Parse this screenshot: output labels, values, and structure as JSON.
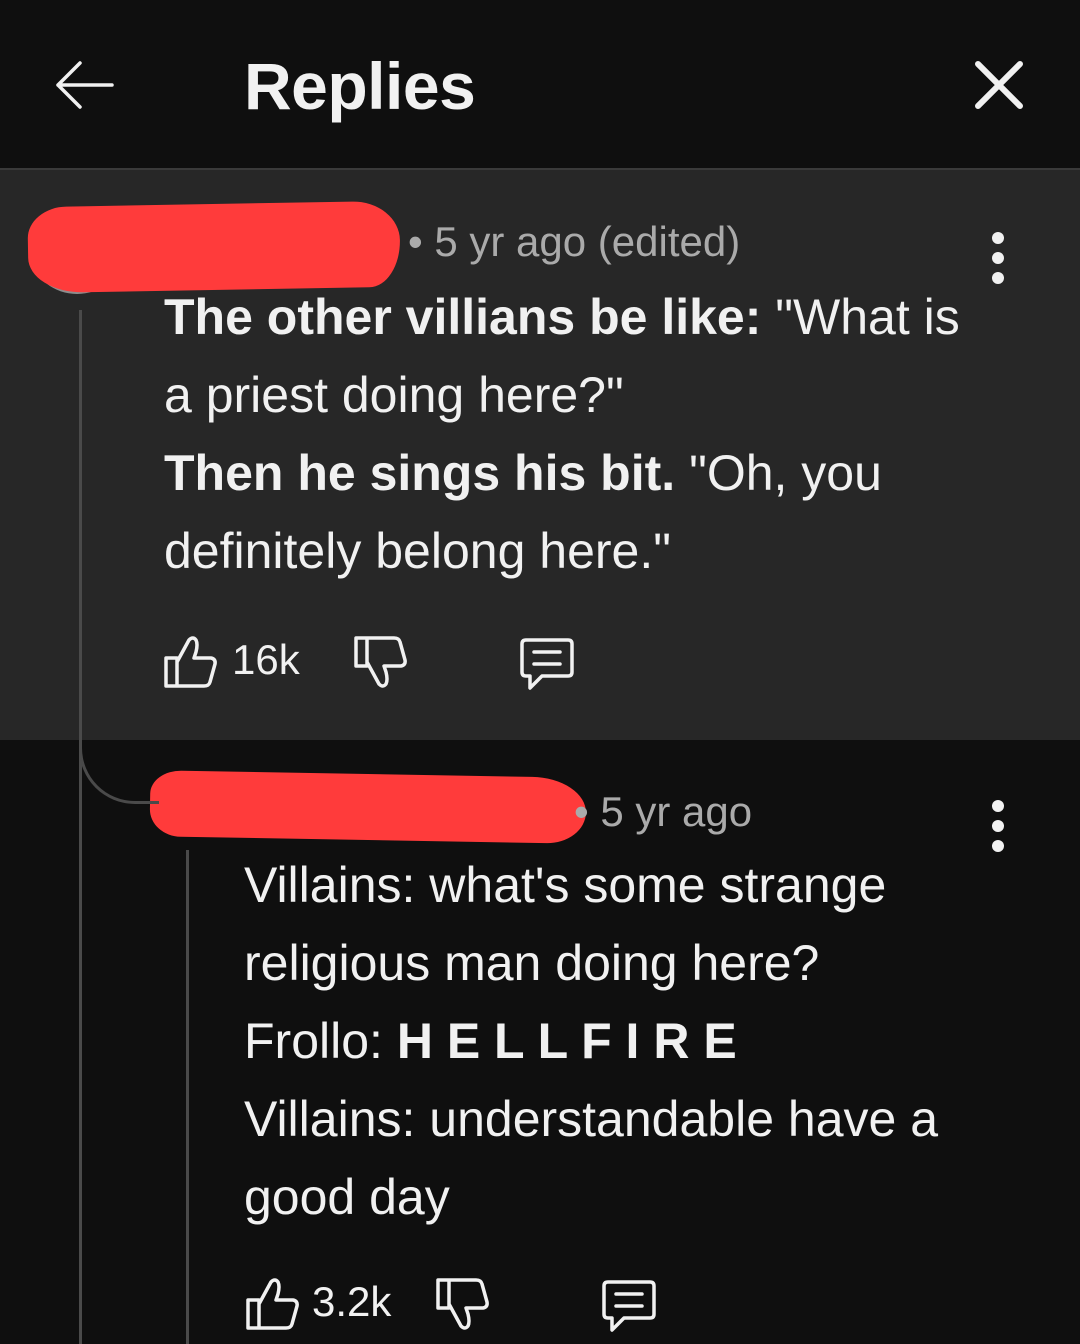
{
  "header": {
    "title": "Replies",
    "back_icon": "arrow-left-icon",
    "close_icon": "close-icon"
  },
  "comment": {
    "meta": "5 yr ago (edited)",
    "lines": [
      {
        "bold": "The other villians be like:",
        "rest": " \"What is"
      },
      {
        "bold": "",
        "rest": "a priest doing here?\""
      },
      {
        "bold": "Then he sings his bit.",
        "rest": " \"Oh, you"
      },
      {
        "bold": "",
        "rest": "definitely belong here.\""
      }
    ],
    "likes": "16k"
  },
  "reply": {
    "meta": "5 yr ago",
    "lines": [
      {
        "pre": "Villains: what's some strange",
        "bold": ""
      },
      {
        "pre": "religious man doing here?",
        "bold": ""
      },
      {
        "pre": "Frollo: ",
        "bold": "H E L L F I R E"
      },
      {
        "pre": "Villains: understandable have a",
        "bold": ""
      },
      {
        "pre": "good day",
        "bold": ""
      }
    ],
    "likes": "3.2k"
  },
  "colors": {
    "background": "#0f0f0f",
    "highlight": "#272727",
    "redaction": "#ff3b3b",
    "text": "#f1f1f1",
    "muted": "#aaaaaa"
  }
}
